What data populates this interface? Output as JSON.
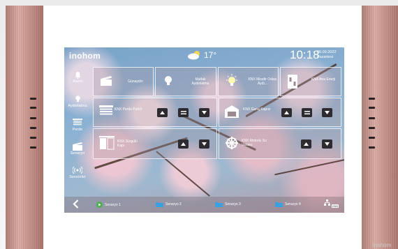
{
  "device": {
    "brand": "inohom",
    "watermark": "inohom"
  },
  "topbar": {
    "weather_icon": "cloud-sun-icon",
    "temperature": "17°",
    "time": "10:18",
    "date": "26.09.2022",
    "day": "Pazartesi"
  },
  "sidebar": {
    "items": [
      {
        "label": "Alarm",
        "icon": "bell-icon"
      },
      {
        "label": "Aydınlatma",
        "icon": "bulb-icon"
      },
      {
        "label": "Perde",
        "icon": "blind-icon"
      },
      {
        "label": "Senaryo",
        "icon": "scenario-icon"
      },
      {
        "label": "Sensörler",
        "icon": "sensor-icon"
      }
    ]
  },
  "cards": {
    "gunaydin": {
      "label": "Günaydın",
      "icon": "clapper-icon"
    },
    "mutfak": {
      "label": "Mutfak Aydınlatma",
      "icon": "bulb-icon"
    },
    "misafir": {
      "label": "KNX Misafir Odası Aydı...",
      "icon": "bulb-on-icon"
    },
    "ana_enerji": {
      "label": "KNX Ana Enerji",
      "icon": "fuse-icon"
    },
    "perde": {
      "label": "KNX Perde Parlör",
      "icon": "blind-icon"
    },
    "garaj": {
      "label": "KNX Garaj Kapısı",
      "icon": "garage-icon"
    },
    "surgulu": {
      "label": "KNX Sürgülü Kapı",
      "icon": "sliding-door-icon"
    },
    "su_vanasi": {
      "label": "KNX Motorlu Su Vanası",
      "icon": "valve-icon"
    }
  },
  "bottombar": {
    "back_icon": "chevron-left-icon",
    "scenes": [
      "Senaryo 1",
      "Senaryo 2",
      "Senaryo 3",
      "Senaryo 4"
    ],
    "network_icon": "network-icon",
    "knx_badge": "KNX"
  },
  "colors": {
    "bezel": "#c8958c",
    "button": "#2d2b2f",
    "scene1_accent": "#4caf50",
    "scene_accent": "#3aa0e0"
  }
}
